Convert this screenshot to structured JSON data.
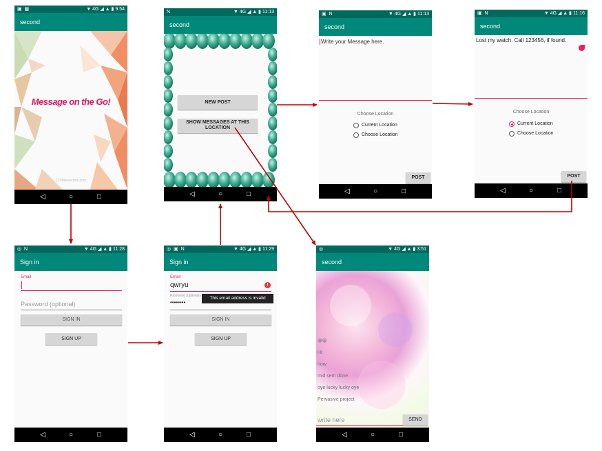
{
  "screens": {
    "splash": {
      "status_time": "9:54",
      "app_title": "second",
      "tagline": "Message on the Go!",
      "watermark": "123freevectors.com",
      "colors": {
        "tagline": "#d81b60"
      }
    },
    "menu": {
      "status_time": "11:13",
      "app_title": "second",
      "new_post_label": "NEW POST",
      "show_messages_label_1": "SHOW MESSAGES AT THIS",
      "show_messages_label_2": "LOCATION"
    },
    "compose_empty": {
      "status_time": "11:13",
      "app_title": "second",
      "message_placeholder": "Write your Message here.",
      "choose_location_heading": "Choose Location",
      "option_current": "Current Location",
      "option_choose": "Choose Location",
      "post_label": "POST"
    },
    "compose_filled": {
      "status_time": "11:16",
      "app_title": "second",
      "message_text": "Lost my watch. Call 123456, if found.",
      "choose_location_heading": "Choose Location",
      "option_current": "Current Location",
      "option_choose": "Choose Location",
      "post_label": "POST"
    },
    "signin_empty": {
      "status_time": "11:28",
      "app_title": "Sign in",
      "email_label": "Email",
      "password_placeholder": "Password (optional)",
      "sign_in_label": "SIGN IN",
      "sign_up_label": "SIGN UP"
    },
    "signin_error": {
      "status_time": "11:29",
      "app_title": "Sign in",
      "email_label": "Email",
      "email_value": "qwryu",
      "password_label": "Password (optional)",
      "password_value": "••••••••",
      "error_tooltip": "This email address is invalid",
      "sign_in_label": "SIGN IN",
      "sign_up_label": "SIGN UP"
    },
    "chat": {
      "status_time": "3:51",
      "app_title": "second",
      "messages": [
        "😀😀",
        "Hi",
        "how",
        "mid sem done",
        "oye lucky lucky oye",
        "Pervasive project"
      ],
      "input_placeholder": "write here",
      "send_label": "SEND"
    }
  },
  "status_icons": "▼ 4G ◢ ▲ ▮",
  "nav": {
    "back": "◁",
    "home": "○",
    "recent": "□"
  },
  "colors": {
    "statusbar": "#00695c",
    "appbar": "#00897b",
    "accent": "#e91e63",
    "arrow": "#c00000"
  }
}
